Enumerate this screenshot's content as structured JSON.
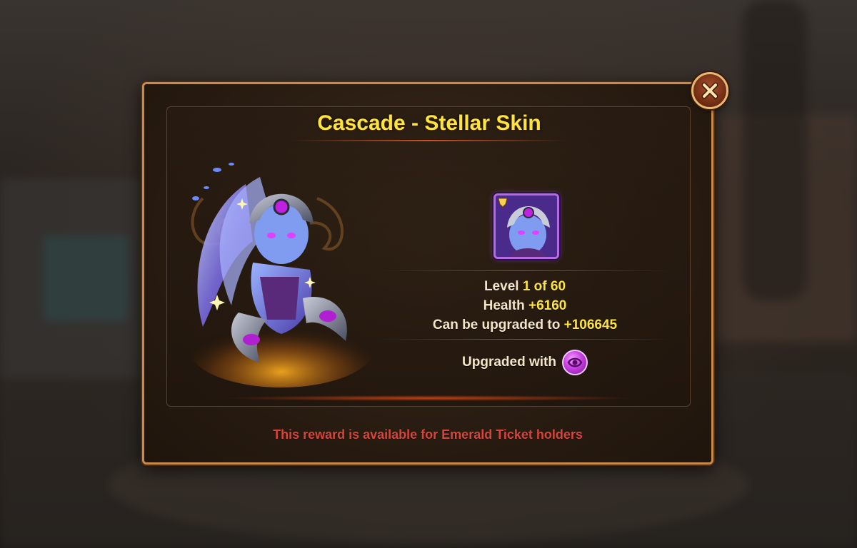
{
  "dialog": {
    "title": "Cascade - Stellar Skin",
    "stats": {
      "level_label": "Level",
      "level_value": "1 of 60",
      "health_label": "Health",
      "health_value": "+6160",
      "upgrade_label": "Can be upgraded to",
      "upgrade_value": "+106645"
    },
    "upgraded_with_label": "Upgraded with",
    "reward_note": "This reward is available for Emerald Ticket holders"
  },
  "icons": {
    "close": "close-icon",
    "skin_portrait": "hero-skin-portrait",
    "upgrade_token": "skin-stone-icon",
    "hero_art": "cascade-hero-art"
  },
  "colors": {
    "title": "#ffe53b",
    "value_highlight": "#ffe53b",
    "reward_note": "#d8453a",
    "frame": "#c98a4a",
    "skin_border": "#b46be0"
  }
}
